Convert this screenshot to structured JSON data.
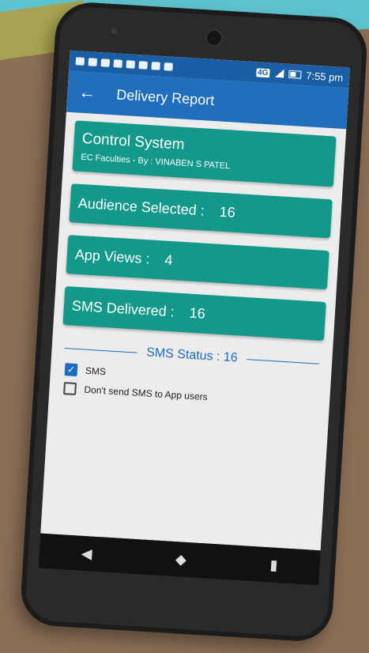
{
  "statusbar": {
    "network": "4G",
    "time": "7:55 pm"
  },
  "appbar": {
    "back_icon": "arrow-left-icon",
    "title": "Delivery Report"
  },
  "summary_card": {
    "title": "Control System",
    "subtitle": "EC Faculties  - By : VINABEN S PATEL"
  },
  "stats": [
    {
      "label": "Audience Selected :",
      "value": "16"
    },
    {
      "label": "App Views :",
      "value": "4"
    },
    {
      "label": "SMS Delivered :",
      "value": "16"
    }
  ],
  "sms_status": {
    "label": "SMS Status : 16"
  },
  "options": [
    {
      "label": "SMS",
      "checked": true
    },
    {
      "label": "Don't send SMS to App users",
      "checked": false
    }
  ],
  "navbar": {
    "back": "◀",
    "home": "◆",
    "recents": "▮"
  },
  "colors": {
    "primary": "#1f6fbd",
    "card": "#13998a"
  }
}
